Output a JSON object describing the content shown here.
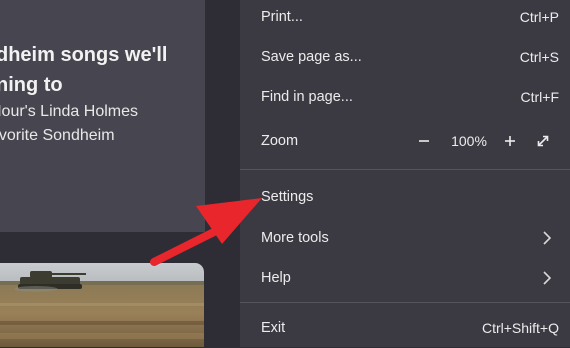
{
  "article": {
    "title_line1": "dheim songs we'll",
    "title_line2": "ning to",
    "desc_line1": "Hour's Linda Holmes",
    "desc_line2": "avorite Sondheim"
  },
  "menu": {
    "print": {
      "label": "Print...",
      "shortcut": "Ctrl+P"
    },
    "save": {
      "label": "Save page as...",
      "shortcut": "Ctrl+S"
    },
    "find": {
      "label": "Find in page...",
      "shortcut": "Ctrl+F"
    },
    "zoom": {
      "label": "Zoom",
      "value": "100%"
    },
    "settings": {
      "label": "Settings"
    },
    "more_tools": {
      "label": "More tools"
    },
    "help": {
      "label": "Help"
    },
    "exit": {
      "label": "Exit",
      "shortcut": "Ctrl+Shift+Q"
    }
  },
  "colors": {
    "page_bg": "#2e2d35",
    "menu_bg": "#3b3a43",
    "card_bg": "#47454f",
    "arrow": "#e8262c"
  },
  "icons": [
    "zoom-out-icon",
    "zoom-in-icon",
    "fullscreen-icon",
    "chevron-right-icon",
    "annotation-arrow"
  ]
}
